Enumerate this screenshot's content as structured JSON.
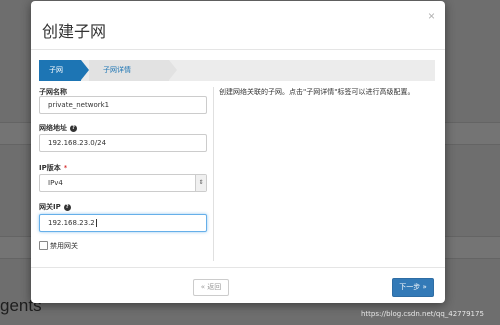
{
  "modal": {
    "title": "创建子网",
    "close_label": "×",
    "tabs": [
      {
        "label": "子网",
        "active": true
      },
      {
        "label": "子网详情",
        "active": false
      }
    ],
    "fields": {
      "subnet_name": {
        "label": "子网名称",
        "value": "private_network1"
      },
      "network_address": {
        "label": "网络地址",
        "value": "192.168.23.0/24",
        "help_icon": "question-circle-icon"
      },
      "ip_version": {
        "label": "IP版本",
        "required_mark": "*",
        "value": "IPv4"
      },
      "gateway_ip": {
        "label": "网关IP",
        "value": "192.168.23.2",
        "help_icon": "question-circle-icon"
      },
      "disable_gateway": {
        "label": "禁用网关",
        "checked": false
      }
    },
    "description": "创建网络关联的子网。点击\"子网详情\"标签可以进行高级配置。",
    "footer": {
      "back_label": "« 返回",
      "next_label": "下一步 »"
    }
  },
  "background": {
    "partial_text": "gents"
  },
  "watermark": "https://blog.csdn.net/qq_42779175",
  "colors": {
    "primary": "#337ab7",
    "tab_active": "#1d75b4",
    "focus_border": "#66afe9",
    "overlay": "#6e6e6e"
  }
}
